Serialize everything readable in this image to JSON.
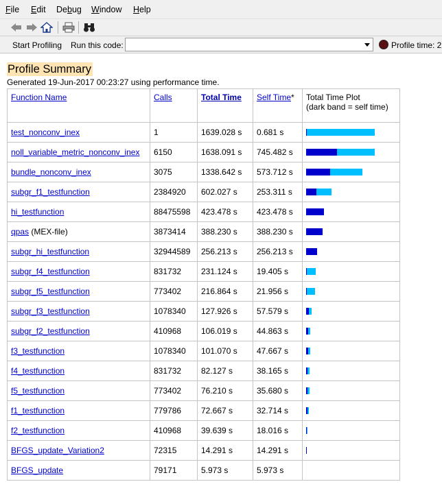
{
  "menu": [
    "File",
    "Edit",
    "Debug",
    "Window",
    "Help"
  ],
  "menu_mnemonics": [
    "F",
    "E",
    "b",
    "W",
    "H"
  ],
  "toolbar": {
    "back_icon": "back-arrow-icon",
    "forward_icon": "forward-arrow-icon",
    "home_icon": "home-icon",
    "print_icon": "print-icon",
    "find_icon": "binoculars-icon"
  },
  "runbar": {
    "start_label": "Start Profiling",
    "run_label": "Run this code:",
    "run_value": "",
    "time_label": "Profile time: 2"
  },
  "summary": {
    "title": "Profile Summary",
    "subtitle": "Generated 19-Jun-2017 00:23:27 using performance time."
  },
  "columns": {
    "function_name": "Function Name",
    "calls": "Calls",
    "total_time": "Total Time",
    "self_time": "Self Time",
    "self_time_mark": "*",
    "plot_line1": "Total Time Plot",
    "plot_line2": "(dark band = self time)"
  },
  "rows": [
    {
      "name": "test_nonconv_inex",
      "suffix": "",
      "calls": "1",
      "total": "1639.028 s",
      "self": "0.681 s",
      "total_val": 1639.028,
      "self_val": 0.681
    },
    {
      "name": "noll_variable_metric_nonconv_inex",
      "suffix": "",
      "calls": "6150",
      "total": "1638.091 s",
      "self": "745.482 s",
      "total_val": 1638.091,
      "self_val": 745.482
    },
    {
      "name": "bundle_nonconv_inex",
      "suffix": "",
      "calls": "3075",
      "total": "1338.642 s",
      "self": "573.712 s",
      "total_val": 1338.642,
      "self_val": 573.712
    },
    {
      "name": "subgr_f1_testfunction",
      "suffix": "",
      "calls": "2384920",
      "total": "602.027 s",
      "self": "253.311 s",
      "total_val": 602.027,
      "self_val": 253.311
    },
    {
      "name": "hi_testfunction",
      "suffix": "",
      "calls": "88475598",
      "total": "423.478 s",
      "self": "423.478 s",
      "total_val": 423.478,
      "self_val": 423.478
    },
    {
      "name": "qpas",
      "suffix": " (MEX-file)",
      "calls": "3873414",
      "total": "388.230 s",
      "self": "388.230 s",
      "total_val": 388.23,
      "self_val": 388.23
    },
    {
      "name": "subgr_hi_testfunction",
      "suffix": "",
      "calls": "32944589",
      "total": "256.213 s",
      "self": "256.213 s",
      "total_val": 256.213,
      "self_val": 256.213
    },
    {
      "name": "subgr_f4_testfunction",
      "suffix": "",
      "calls": "831732",
      "total": "231.124 s",
      "self": "19.405 s",
      "total_val": 231.124,
      "self_val": 19.405
    },
    {
      "name": "subgr_f5_testfunction",
      "suffix": "",
      "calls": "773402",
      "total": "216.864 s",
      "self": "21.956 s",
      "total_val": 216.864,
      "self_val": 21.956
    },
    {
      "name": "subgr_f3_testfunction",
      "suffix": "",
      "calls": "1078340",
      "total": "127.926 s",
      "self": "57.579 s",
      "total_val": 127.926,
      "self_val": 57.579
    },
    {
      "name": "subgr_f2_testfunction",
      "suffix": "",
      "calls": "410968",
      "total": "106.019 s",
      "self": "44.863 s",
      "total_val": 106.019,
      "self_val": 44.863
    },
    {
      "name": "f3_testfunction",
      "suffix": "",
      "calls": "1078340",
      "total": "101.070 s",
      "self": "47.667 s",
      "total_val": 101.07,
      "self_val": 47.667
    },
    {
      "name": "f4_testfunction",
      "suffix": "",
      "calls": "831732",
      "total": "82.127 s",
      "self": "38.165 s",
      "total_val": 82.127,
      "self_val": 38.165
    },
    {
      "name": "f5_testfunction",
      "suffix": "",
      "calls": "773402",
      "total": "76.210 s",
      "self": "35.680 s",
      "total_val": 76.21,
      "self_val": 35.68
    },
    {
      "name": "f1_testfunction",
      "suffix": "",
      "calls": "779786",
      "total": "72.667 s",
      "self": "32.714 s",
      "total_val": 72.667,
      "self_val": 32.714
    },
    {
      "name": "f2_testfunction",
      "suffix": "",
      "calls": "410968",
      "total": "39.639 s",
      "self": "18.016 s",
      "total_val": 39.639,
      "self_val": 18.016
    },
    {
      "name": "BFGS_update_Variation2",
      "suffix": "",
      "calls": "72315",
      "total": "14.291 s",
      "self": "14.291 s",
      "total_val": 14.291,
      "self_val": 14.291
    },
    {
      "name": "BFGS_update",
      "suffix": "",
      "calls": "79171",
      "total": "5.973 s",
      "self": "5.973 s",
      "total_val": 5.973,
      "self_val": 5.973
    }
  ],
  "colors": {
    "self_band": "#0000cd",
    "total_band": "#00bfff",
    "title_bg": "#ffe4b3"
  }
}
